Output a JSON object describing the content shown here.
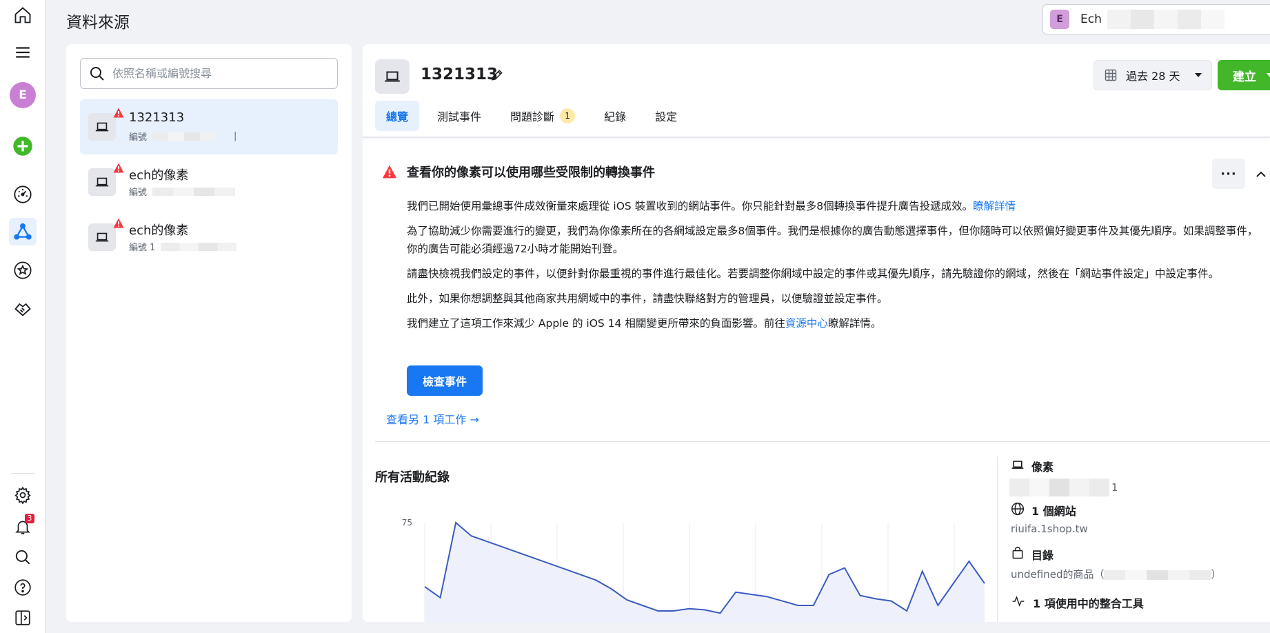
{
  "header": {
    "title": "資料來源"
  },
  "account": {
    "initial": "E",
    "name": "Ech"
  },
  "rail": {
    "profile_initial": "E",
    "notification_count": "3"
  },
  "search": {
    "placeholder": "依照名稱或編號搜尋"
  },
  "sources": [
    {
      "name": "1321313",
      "id_label": "編號",
      "id_tail": "|",
      "warning": true,
      "selected": true
    },
    {
      "name": "ech的像素",
      "id_label": "編號",
      "id_tail": "",
      "warning": true,
      "selected": false
    },
    {
      "name": "ech的像素",
      "id_label": "編號 1",
      "id_tail": "",
      "warning": true,
      "selected": false
    }
  ],
  "pixel": {
    "name": "1321313"
  },
  "date_range": {
    "label": "過去 28 天"
  },
  "create_button": {
    "label": "建立"
  },
  "tabs": [
    {
      "label": "總覽",
      "active": true
    },
    {
      "label": "測試事件"
    },
    {
      "label": "問題診斷",
      "badge": "1"
    },
    {
      "label": "紀錄"
    },
    {
      "label": "設定"
    }
  ],
  "alert": {
    "title": "查看你的像素可以使用哪些受限制的轉換事件",
    "p1": "我們已開始使用彙總事件成效衡量來處理從 iOS 裝置收到的網站事件。你只能針對最多8個轉換事件提升廣告投遞成效。",
    "p1_link": "瞭解詳情",
    "p2": "為了協助減少你需要進行的變更，我們為你像素所在的各網域設定最多8個事件。我們是根據你的廣告動態選擇事件，但你隨時可以依照偏好變更事件及其優先順序。如果調整事件，你的廣告可能必須經過72小時才能開始刊登。",
    "p3": "請盡快檢視我們設定的事件，以便針對你最重視的事件進行最佳化。若要調整你網域中設定的事件或其優先順序，請先驗證你的網域，然後在「網站事件設定」中設定事件。",
    "p4": "此外，如果你想調整與其他商家共用網域中的事件，請盡快聯絡對方的管理員，以便驗證並設定事件。",
    "p5_before": "我們建立了這項工作來減少 Apple 的 iOS 14 相關變更所帶來的負面影響。前往",
    "p5_link": "資源中心",
    "p5_after": "瞭解詳情。",
    "button": "檢查事件",
    "more_tasks": "查看另 1 項工作 →"
  },
  "activity": {
    "title": "所有活動紀錄"
  },
  "chart_data": {
    "type": "area",
    "yticks": [
      "75"
    ],
    "ylim": [
      0,
      75
    ],
    "series": [
      {
        "values": [
          17,
          7,
          75,
          63,
          58,
          53,
          48,
          43,
          38,
          33,
          28,
          23,
          15,
          5,
          0,
          -5,
          -5,
          -3,
          -4,
          -7,
          12,
          10,
          8,
          4,
          0,
          0,
          28,
          34,
          9,
          6,
          4,
          -5,
          31,
          0,
          20,
          40,
          20
        ]
      }
    ],
    "color": "#3b5bbf",
    "fill": "#eef1fb"
  },
  "details": {
    "pixel_label": "像素",
    "pixel_id_tail": "1",
    "websites_label": "1 個網站",
    "website": "riuifa.1shop.tw",
    "catalog_label": "目錄",
    "catalog_value": "undefined的商品（",
    "catalog_tail": "）",
    "integrations_label": "1 項使用中的整合工具"
  }
}
